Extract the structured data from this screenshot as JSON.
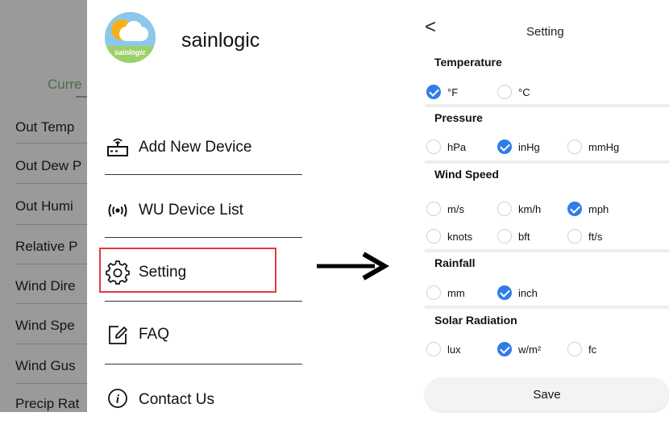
{
  "background": {
    "current_label": "Curre",
    "rows": [
      "Out Temp",
      "Out Dew P",
      "Out Humi",
      "Relative P",
      "Wind Dire",
      "Wind Spe",
      "Wind Gus",
      "Precip Rat"
    ]
  },
  "drawer": {
    "brand": "sainlogic",
    "logo_text": "sainlogic",
    "items": [
      {
        "label": "Add New Device",
        "icon": "router-icon"
      },
      {
        "label": "WU Device List",
        "icon": "wireless-signal-icon"
      },
      {
        "label": "Setting",
        "icon": "gear-icon"
      },
      {
        "label": "FAQ",
        "icon": "edit-icon"
      },
      {
        "label": "Contact Us",
        "icon": "info-icon"
      }
    ]
  },
  "settings": {
    "back_glyph": "<",
    "title": "Setting",
    "sections": [
      {
        "title": "Temperature",
        "options": [
          [
            "°F",
            "°C"
          ]
        ],
        "selected": "°F"
      },
      {
        "title": "Pressure",
        "options": [
          [
            "hPa",
            "inHg",
            "mmHg"
          ]
        ],
        "selected": "inHg"
      },
      {
        "title": "Wind Speed",
        "options": [
          [
            "m/s",
            "km/h",
            "mph"
          ],
          [
            "knots",
            "bft",
            "ft/s"
          ]
        ],
        "selected": "mph"
      },
      {
        "title": "Rainfall",
        "options": [
          [
            "mm",
            "inch"
          ]
        ],
        "selected": "inch"
      },
      {
        "title": "Solar Radiation",
        "options": [
          [
            "lux",
            "w/m²",
            "fc"
          ]
        ],
        "selected": "w/m²"
      }
    ],
    "save_label": "Save"
  },
  "colors": {
    "accent": "#2f7de8",
    "highlight": "#e23b3b",
    "dim": "#9a9a9a"
  }
}
